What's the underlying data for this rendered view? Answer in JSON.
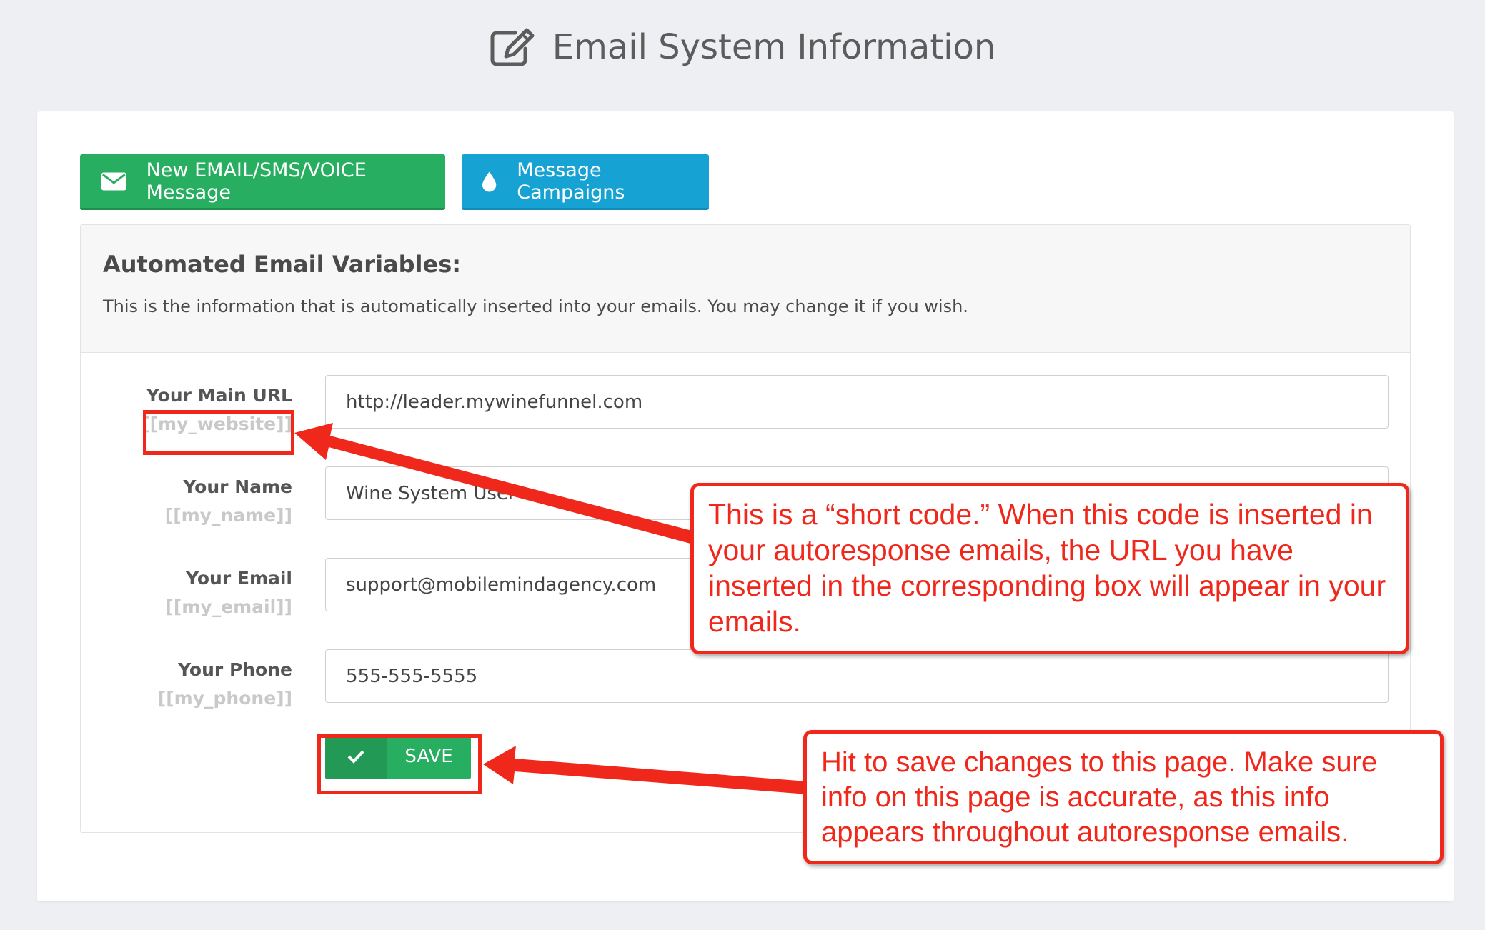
{
  "header": {
    "title": "Email System Information",
    "icon": "edit-icon"
  },
  "toolbar": {
    "new_message_label": "New EMAIL/SMS/VOICE Message",
    "new_message_icon": "envelope-icon",
    "campaigns_label": "Message Campaigns",
    "campaigns_icon": "drop-icon"
  },
  "panel": {
    "title": "Automated Email Variables:",
    "subtitle": "This is the information that is automatically inserted into your emails. You may change it if you wish."
  },
  "fields": [
    {
      "label": "Your Main URL",
      "code": "[[my_website]]",
      "value": "http://leader.mywinefunnel.com"
    },
    {
      "label": "Your Name",
      "code": "[[my_name]]",
      "value": "Wine System User"
    },
    {
      "label": "Your Email",
      "code": "[[my_email]]",
      "value": "support@mobilemindagency.com"
    },
    {
      "label": "Your Phone",
      "code": "[[my_phone]]",
      "value": "555-555-5555"
    }
  ],
  "save": {
    "label": "SAVE",
    "icon": "check-icon"
  },
  "annotations": {
    "shortcode_note": "This is a “short code.” When this code is inserted in your autoresponse emails, the URL you have inserted in the corresponding box will appear in your emails.",
    "save_note": "Hit to save changes to this page. Make sure info on this page is accurate, as this info appears throughout autoresponse emails."
  },
  "colors": {
    "accent_green": "#27ae60",
    "accent_blue": "#17a2d4",
    "annotation_red": "#f0281c"
  }
}
